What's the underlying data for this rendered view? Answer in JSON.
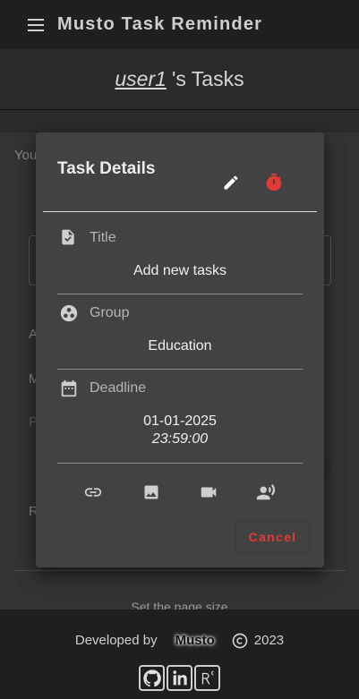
{
  "appbar": {
    "title": "Musto Task Reminder"
  },
  "header": {
    "username": "user1",
    "suffix": "'s Tasks"
  },
  "background": {
    "partial_text_1": "You",
    "partial_text_2": "A",
    "partial_text_3": "M",
    "partial_text_4": "P",
    "partial_text_5": "R",
    "overlay_text": "Set the page size"
  },
  "dialog": {
    "title": "Task Details",
    "fields": {
      "title": {
        "label": "Title",
        "value": "Add new tasks"
      },
      "group": {
        "label": "Group",
        "value": "Education"
      },
      "deadline": {
        "label": "Deadline",
        "date": "01-01-2025",
        "time": "23:59:00"
      }
    },
    "cancel_label": "Cancel"
  },
  "footer": {
    "developed_by": "Developed by",
    "brand": "Musto",
    "year": "2023"
  },
  "colors": {
    "accent_red": "#e53935",
    "appbar": "#1f1f1f",
    "dialog": "#424242"
  }
}
